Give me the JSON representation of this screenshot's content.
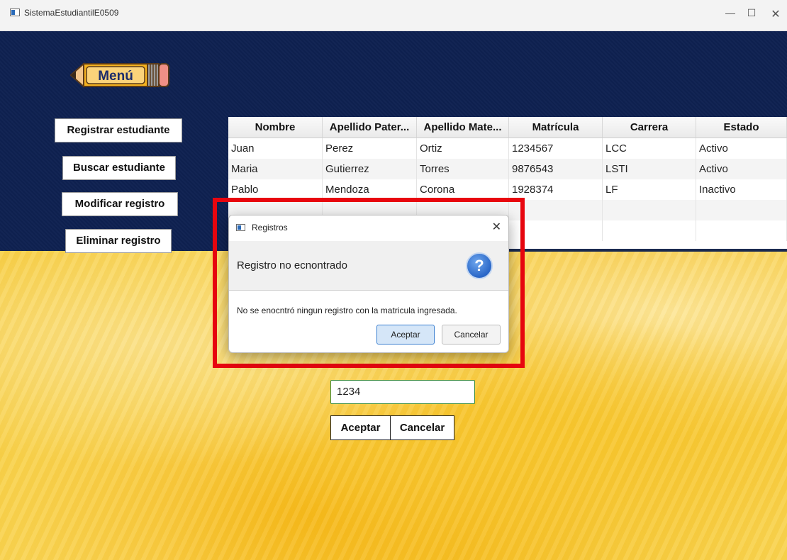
{
  "window": {
    "title": "SistemaEstudiantilE0509",
    "minimize": "—",
    "maximize": "☐",
    "close": "✕"
  },
  "menu": {
    "label": "Menú"
  },
  "sidebar": {
    "register": "Registrar estudiante",
    "search": "Buscar estudiante",
    "modify": "Modificar registro",
    "delete": "Eliminar registro"
  },
  "table": {
    "headers": [
      "Nombre",
      "Apellido Pater...",
      "Apellido Mate...",
      "Matrícula",
      "Carrera",
      "Estado"
    ],
    "rows": [
      [
        "Juan",
        "Perez",
        "Ortiz",
        "1234567",
        "LCC",
        "Activo"
      ],
      [
        "Maria",
        "Gutierrez",
        "Torres",
        "9876543",
        "LSTI",
        "Activo"
      ],
      [
        "Pablo",
        "Mendoza",
        "Corona",
        "1928374",
        "LF",
        "Inactivo"
      ]
    ]
  },
  "form": {
    "matricula_value": "1234",
    "accept": "Aceptar",
    "cancel": "Cancelar"
  },
  "dialog": {
    "title": "Registros",
    "close": "✕",
    "header": "Registro no ecnontrado",
    "icon": "?",
    "body": "No se enocntró ningun registro con la matricula ingresada.",
    "accept": "Aceptar",
    "cancel": "Cancelar"
  },
  "colors": {
    "navy": "#0e2151",
    "highlight": "#e8060f",
    "accent": "#3b7fd0"
  }
}
